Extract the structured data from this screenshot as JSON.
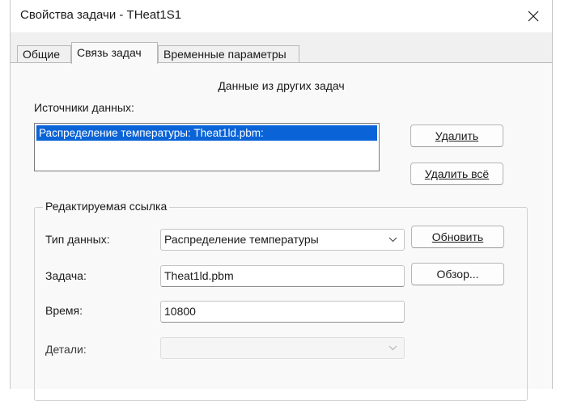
{
  "window": {
    "title": "Свойства задачи - THeat1S1"
  },
  "tabs": [
    {
      "label": "Общие",
      "active": false
    },
    {
      "label": "Связь задач",
      "active": true
    },
    {
      "label": "Временные параметры",
      "active": false
    }
  ],
  "panel": {
    "heading": "Данные из других задач",
    "sources_label": "Источники данных:",
    "sources": [
      "Распределение температуры:  Theat1ld.pbm:"
    ],
    "buttons": {
      "delete": "Удалить",
      "delete_all": "Удалить всё",
      "refresh": "Обновить",
      "browse": "Обзор..."
    }
  },
  "link": {
    "group_title": "Редактируемая ссылка",
    "data_type": {
      "label": "Тип данных:",
      "value": "Распределение температуры"
    },
    "task": {
      "label": "Задача:",
      "value": "Theat1ld.pbm"
    },
    "time": {
      "label": "Время:",
      "value": "10800"
    },
    "details": {
      "label": "Детали:",
      "value": ""
    }
  },
  "colors": {
    "selection": "#0a64d8",
    "window_bg": "#f0f0f0",
    "panel_bg": "#f9f9f9"
  },
  "icons": {
    "close": "close-icon",
    "dropdown": "chevron-down-icon"
  }
}
